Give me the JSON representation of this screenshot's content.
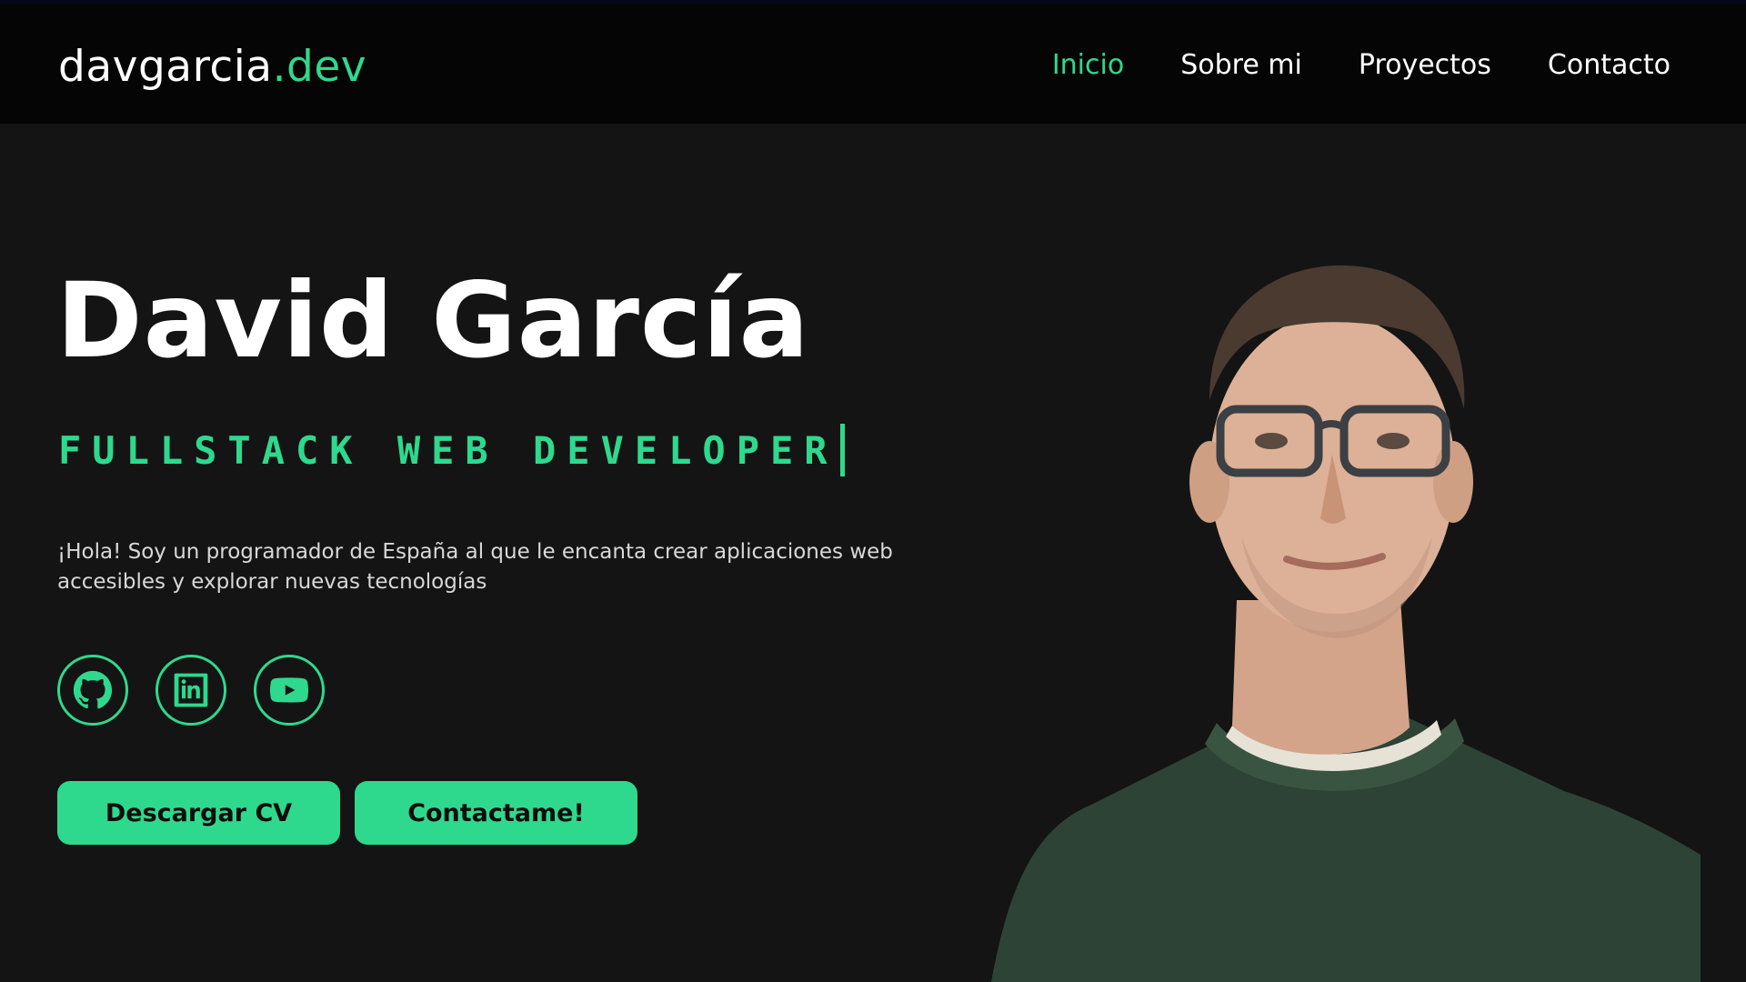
{
  "header": {
    "logo_main": "davgarcia",
    "logo_accent": ".dev",
    "nav": [
      "Inicio",
      "Sobre mi",
      "Proyectos",
      "Contacto"
    ],
    "active_nav": "Inicio"
  },
  "hero": {
    "name": "David García",
    "role": "FULLSTACK WEB DEVELOPER",
    "intro": "¡Hola! Soy un programador de España al que le encanta crear aplicaciones web accesibles y explorar nuevas tecnologías",
    "socials": [
      {
        "icon": "github-icon"
      },
      {
        "icon": "linkedin-icon"
      },
      {
        "icon": "youtube-icon"
      }
    ],
    "buttons": {
      "cv": "Descargar CV",
      "contact": "Contactame!"
    }
  },
  "colors": {
    "accent": "#2ed98e",
    "background": "#141414",
    "header_bg": "#050505"
  }
}
